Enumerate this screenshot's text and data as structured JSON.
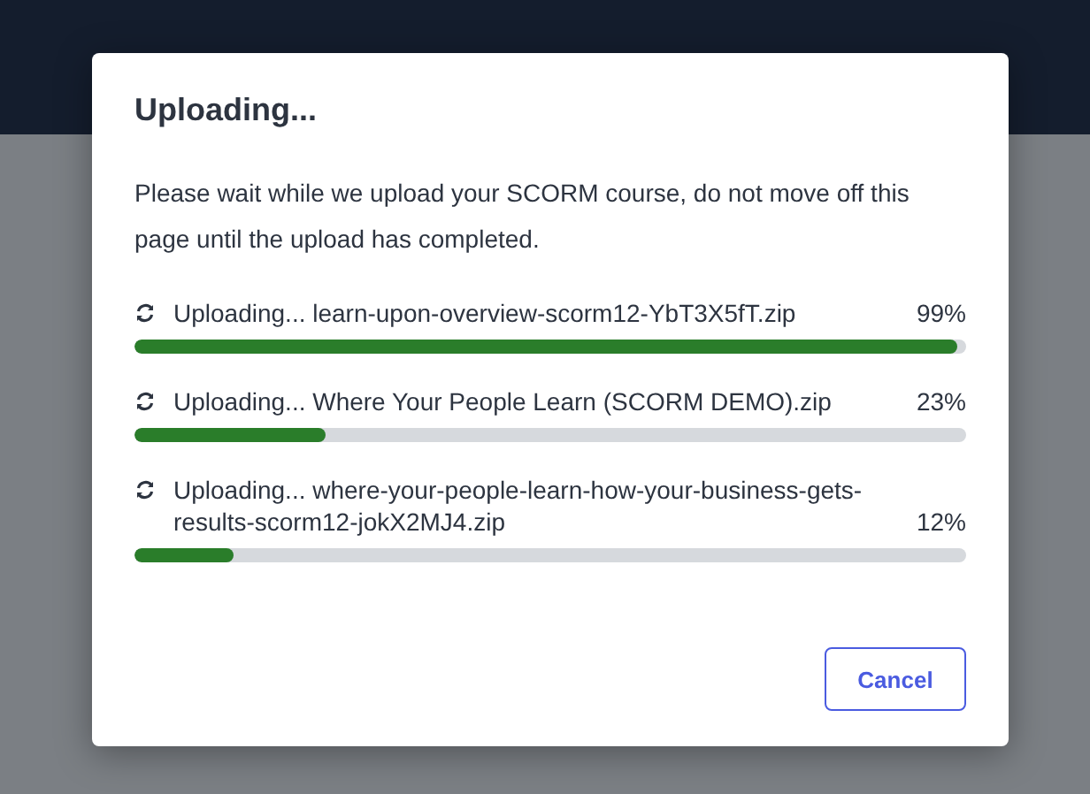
{
  "dialog": {
    "title": "Uploading...",
    "message": "Please wait while we upload your SCORM course, do not move off this page until the upload has completed.",
    "uploads": [
      {
        "label": "Uploading... learn-upon-overview-scorm12-YbT3X5fT.zip",
        "percent": "99%",
        "level": 0.99
      },
      {
        "label": "Uploading... Where Your People Learn (SCORM DEMO).zip",
        "percent": "23%",
        "level": 0.23
      },
      {
        "label": "Uploading... where-your-people-learn-how-your-business-gets-results-scorm12-jokX2MJ4.zip",
        "percent": "12%",
        "level": 0.12
      }
    ],
    "buttons": [
      "Cancel"
    ]
  }
}
